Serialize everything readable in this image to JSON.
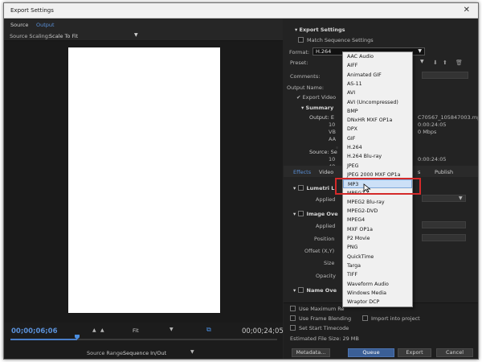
{
  "title": "Export Settings",
  "close_glyph": "✕",
  "source_tabs": [
    "Source",
    "Output"
  ],
  "source_scaling": {
    "label": "Source Scaling:",
    "value": "Scale To Fit"
  },
  "timeline": {
    "current": "00;00;06;06",
    "fit_label": "Fit",
    "end": "00;00;24;05",
    "playhead_fraction": 0.25
  },
  "source_range": {
    "label": "Source Range:",
    "value": "Sequence In/Out"
  },
  "export_settings": {
    "header": "Export Settings",
    "match_sequence": "Match Sequence Settings",
    "format_label": "Format:",
    "format_value": "H.264",
    "preset_label": "Preset:",
    "comments_label": "Comments:",
    "output_name_label": "Output Name:",
    "export_video": "Export Video",
    "summary_header": "Summary",
    "output_label": "Output: E",
    "output_path_tail": "C70567_105847003.mp4",
    "output_line_1": "10",
    "output_line_2": "VB",
    "output_line_3": "AA",
    "output_right_1": "0:00:24:05",
    "output_right_2": "0 Mbps",
    "source_label": "Source: Se",
    "source_line_1": "10",
    "source_line_2": "48",
    "source_right_1": "0:00:24:05"
  },
  "tabs": {
    "effects": "Effects",
    "video": "Video",
    "captions_tail": "s",
    "publish": "Publish"
  },
  "effects": {
    "lumetri": "Lumetri L",
    "applied_1": "Applied",
    "image_overlay": "Image Ove",
    "applied_2": "Applied",
    "position": "Position",
    "offset": "Offset (X,Y)",
    "size": "Size",
    "opacity": "Opacity",
    "name_overlay": "Name Ove"
  },
  "bottom": {
    "max_render": "Use Maximum Re",
    "frame_blending": "Use Frame Blending",
    "import_project": "Import into project",
    "set_start_tc": "Set Start Timecode",
    "file_size": "Estimated File Size:  29 MB",
    "metadata": "Metadata...",
    "queue": "Queue",
    "export": "Export",
    "cancel": "Cancel"
  },
  "format_menu": {
    "items": [
      "AAC Audio",
      "AIFF",
      "Animated GIF",
      "AS-11",
      "AVI",
      "AVI (Uncompressed)",
      "BMP",
      "DNxHR MXF OP1a",
      "DPX",
      "GIF",
      "H.264",
      "H.264 Blu-ray",
      "JPEG",
      "JPEG 2000 MXF OP1a",
      "MP3",
      "MPEG2",
      "MPEG2 Blu-ray",
      "MPEG2-DVD",
      "MPEG4",
      "MXF OP1a",
      "P2 Movie",
      "PNG",
      "QuickTime",
      "Targa",
      "TIFF",
      "Waveform Audio",
      "Windows Media",
      "Wraptor DCP"
    ],
    "checked_item": "H.264",
    "highlighted_item": "MP3"
  },
  "colors": {
    "accent": "#4a8ee0",
    "highlight_box": "#d42a2a",
    "menu_selection": "#cce0f7"
  }
}
